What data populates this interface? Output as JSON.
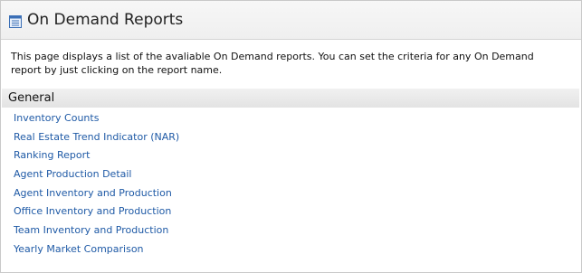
{
  "page": {
    "title": "On Demand Reports",
    "icon": "report-list-icon",
    "description": "This page displays a list of the avaliable On Demand reports. You can set the criteria for any On Demand report by just clicking on the report name."
  },
  "section": {
    "title": "General"
  },
  "reports": [
    "Inventory Counts",
    "Real Estate Trend Indicator (NAR)",
    "Ranking Report",
    "Agent Production Detail",
    "Agent Inventory and Production",
    "Office Inventory and Production",
    "Team Inventory and Production",
    "Yearly Market Comparison"
  ],
  "colors": {
    "link": "#1f5aa6",
    "icon_accent": "#3b6fb6"
  }
}
